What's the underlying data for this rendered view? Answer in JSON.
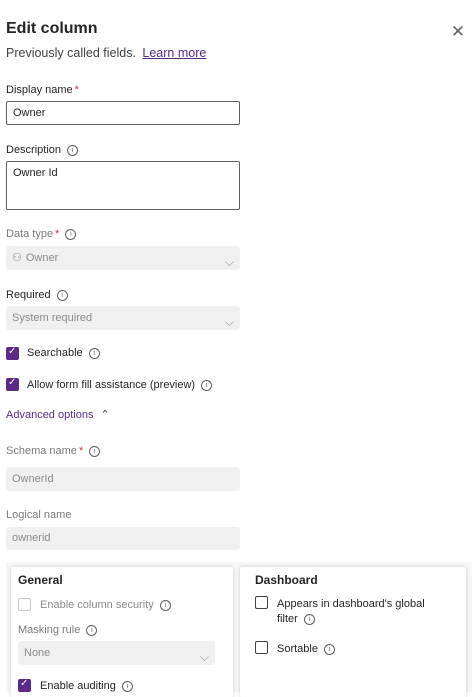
{
  "header": {
    "title": "Edit column",
    "subtitle": "Previously called fields.",
    "learn_more": "Learn more"
  },
  "display_name": {
    "label": "Display name",
    "required_mark": "*",
    "value": "Owner"
  },
  "description": {
    "label": "Description",
    "value": "Owner Id"
  },
  "data_type": {
    "label": "Data type",
    "required_mark": "*",
    "value": "Owner"
  },
  "required": {
    "label": "Required",
    "value": "System required"
  },
  "searchable": {
    "label": "Searchable",
    "checked": true
  },
  "form_fill": {
    "label": "Allow form fill assistance (preview)",
    "checked": true
  },
  "advanced": {
    "label": "Advanced options"
  },
  "schema_name": {
    "label": "Schema name",
    "required_mark": "*",
    "value": "OwnerId"
  },
  "logical_name": {
    "label": "Logical name",
    "value": "ownerid"
  },
  "general": {
    "title": "General",
    "column_security": "Enable column security",
    "masking_rule_label": "Masking rule",
    "masking_rule_value": "None",
    "auditing": "Enable auditing"
  },
  "dashboard": {
    "title": "Dashboard",
    "global_filter_line1": "Appears in dashboard's global",
    "global_filter_line2": "filter",
    "sortable": "Sortable"
  },
  "colors": {
    "accent": "#5b2a86",
    "required": "#c4314b"
  }
}
